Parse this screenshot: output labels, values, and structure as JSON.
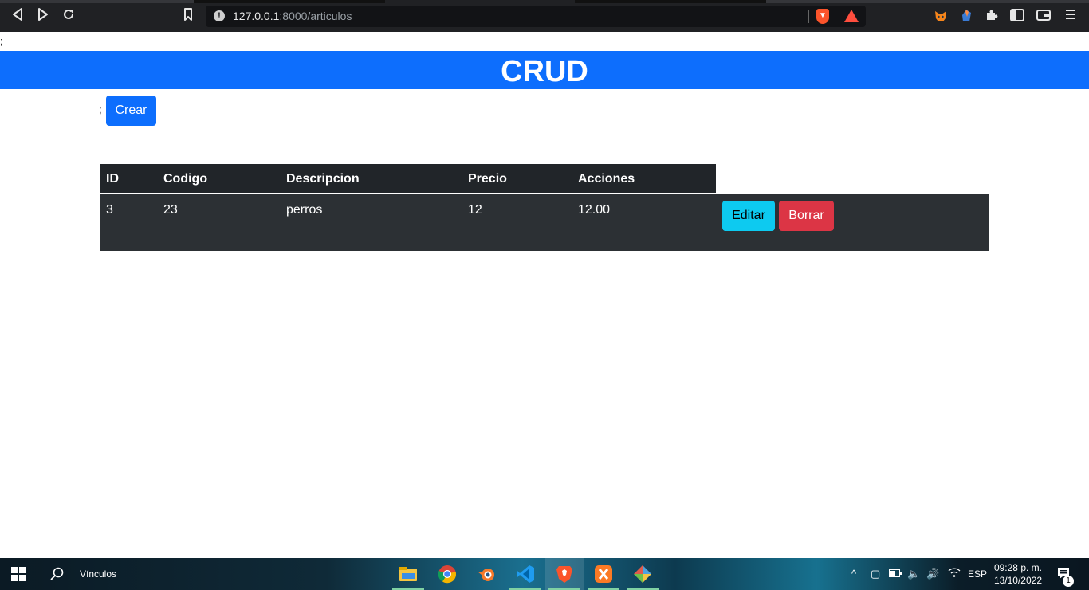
{
  "browser": {
    "url_host": "127.0.0.1",
    "url_path": ":8000/articulos"
  },
  "page": {
    "stray_top": ";",
    "stray_before_button": ";",
    "header_title": "CRUD",
    "create_label": "Crear"
  },
  "table": {
    "headers": [
      "ID",
      "Codigo",
      "Descripcion",
      "Precio",
      "Acciones"
    ],
    "rows": [
      {
        "id": "3",
        "codigo": "23",
        "descripcion": "perros",
        "precio": "12",
        "extra": "12.00",
        "edit_label": "Editar",
        "delete_label": "Borrar"
      }
    ]
  },
  "taskbar": {
    "search_label": "Vínculos",
    "language": "ESP",
    "time": "09:28 p. m.",
    "date": "13/10/2022",
    "notification_count": "1"
  },
  "colors": {
    "primary": "#0d6efd",
    "info": "#0dcaf0",
    "danger": "#dc3545",
    "table_dark": "#212529"
  }
}
